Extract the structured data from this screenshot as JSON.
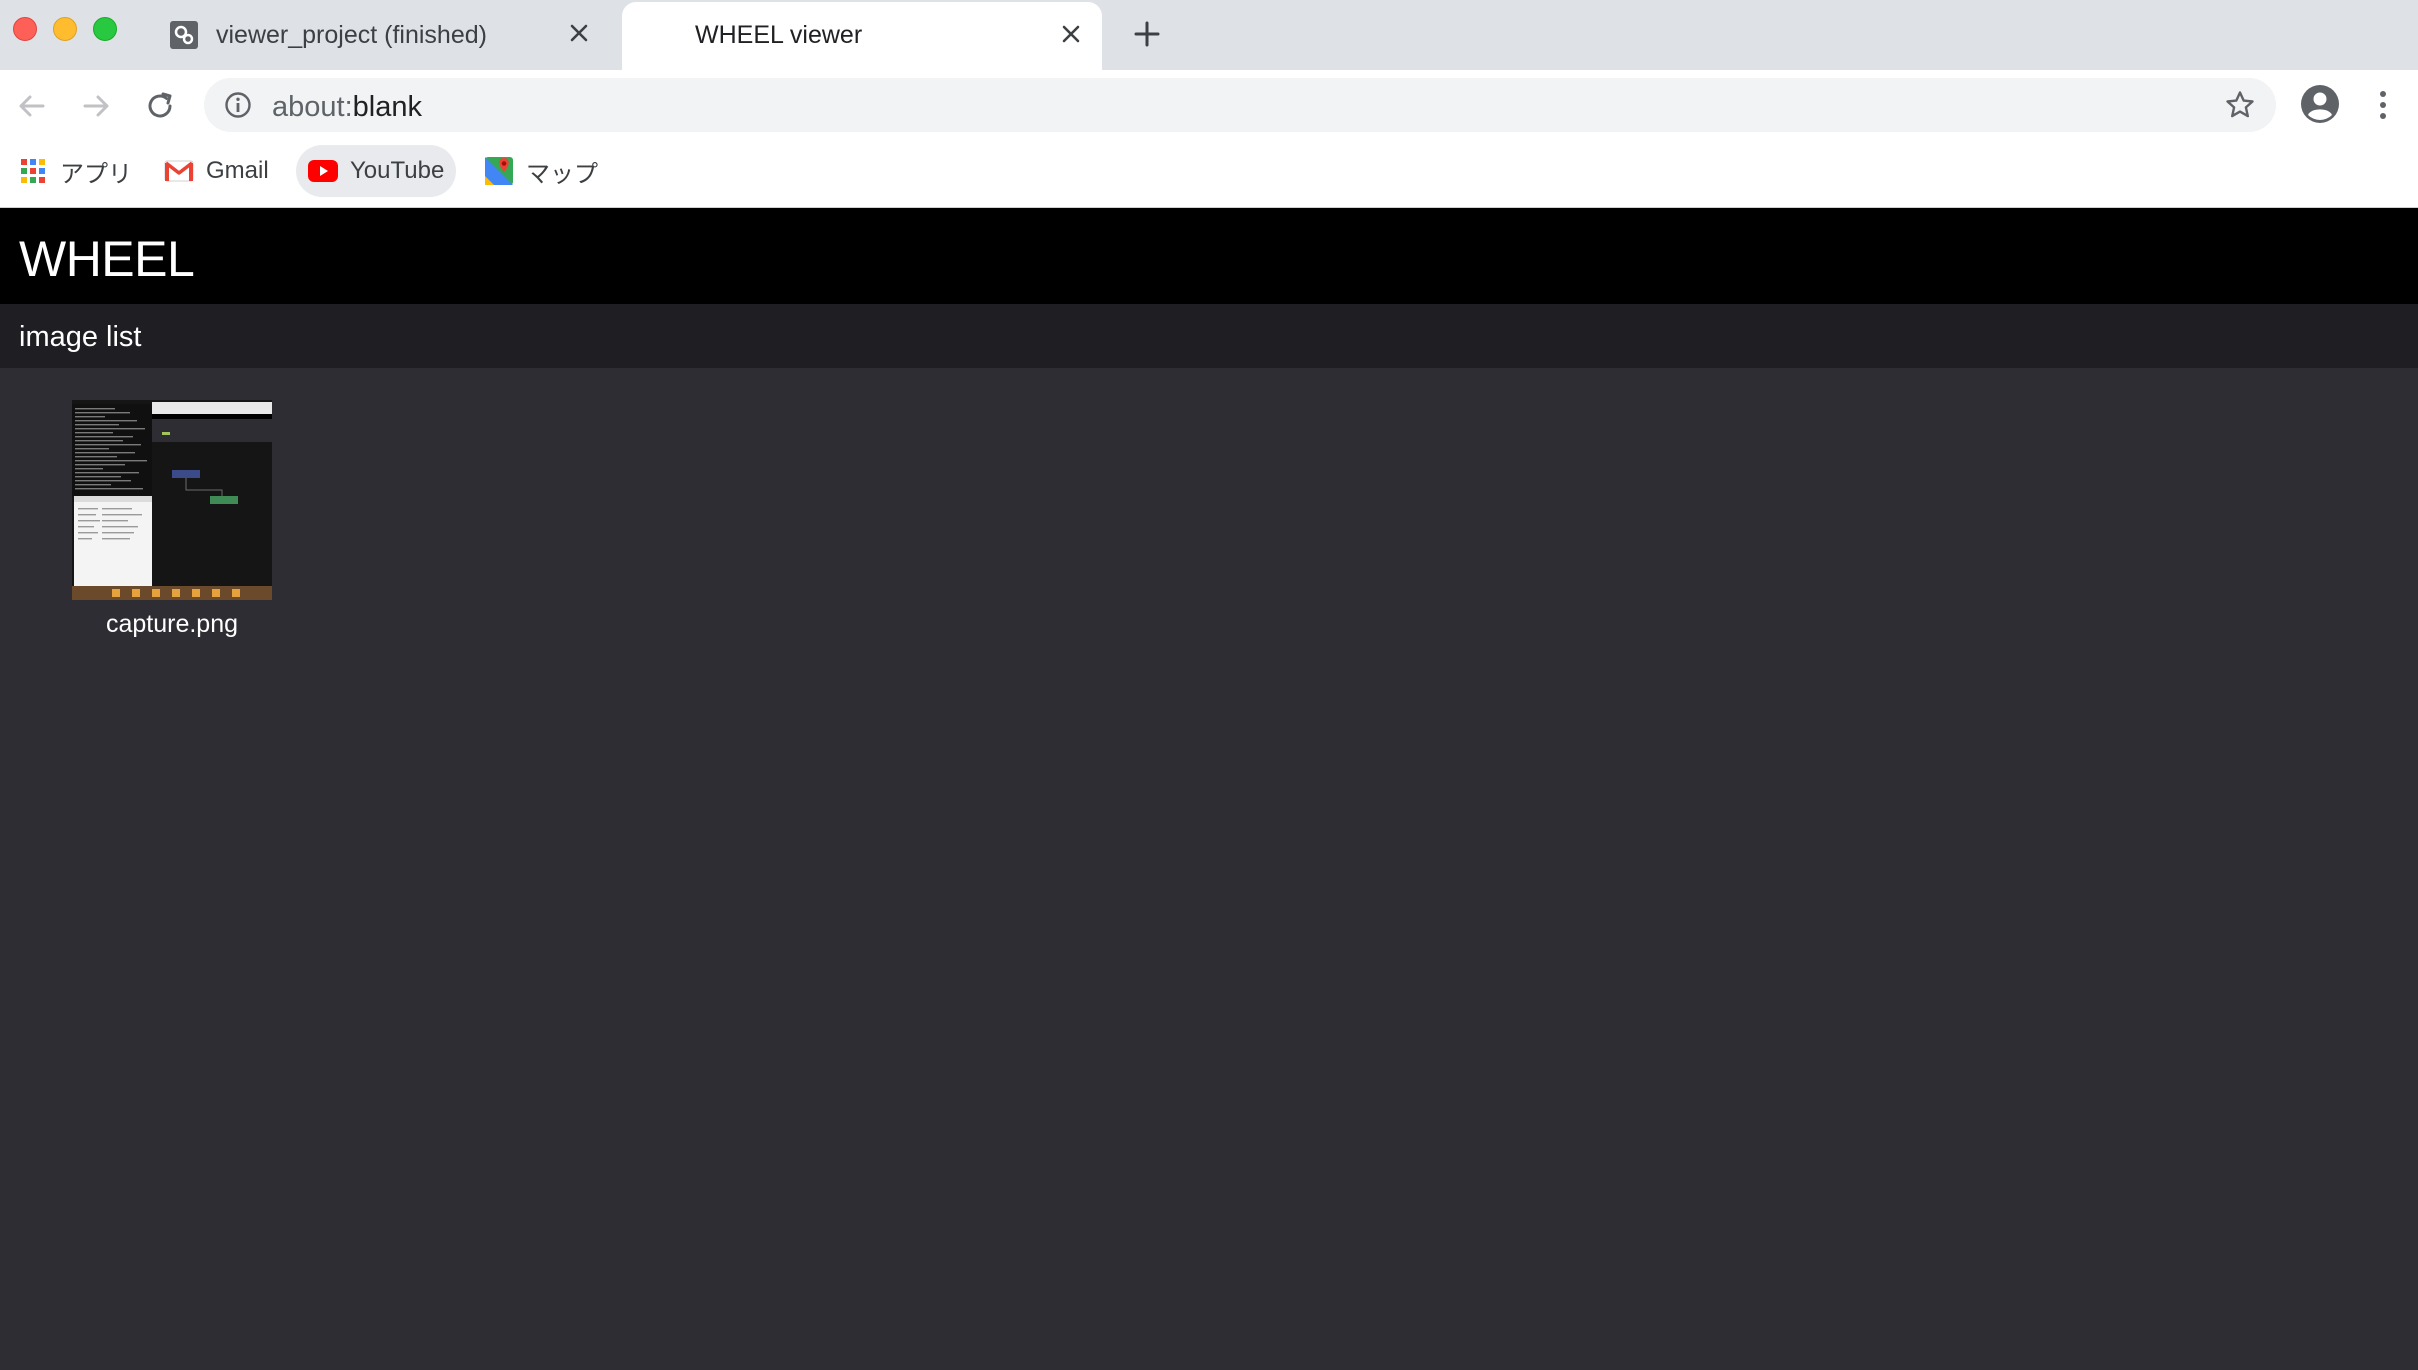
{
  "browser": {
    "tabs": [
      {
        "title": "viewer_project (finished)",
        "active": false
      },
      {
        "title": "WHEEL viewer",
        "active": true
      }
    ],
    "address_bar": {
      "scheme": "about:",
      "host": "blank"
    },
    "bookmarks": [
      {
        "label": "アプリ",
        "icon": "apps-grid-icon"
      },
      {
        "label": "Gmail",
        "icon": "gmail-icon"
      },
      {
        "label": "YouTube",
        "icon": "youtube-icon"
      },
      {
        "label": "マップ",
        "icon": "maps-icon"
      }
    ]
  },
  "app": {
    "title": "WHEEL",
    "section_title": "image list",
    "images": [
      {
        "filename": "capture.png"
      }
    ]
  },
  "colors": {
    "page_background": "#2e2d33",
    "header_background": "#000000",
    "subheader_background": "#1f1e23",
    "text": "#ffffff",
    "youtube_red": "#ff0000"
  }
}
